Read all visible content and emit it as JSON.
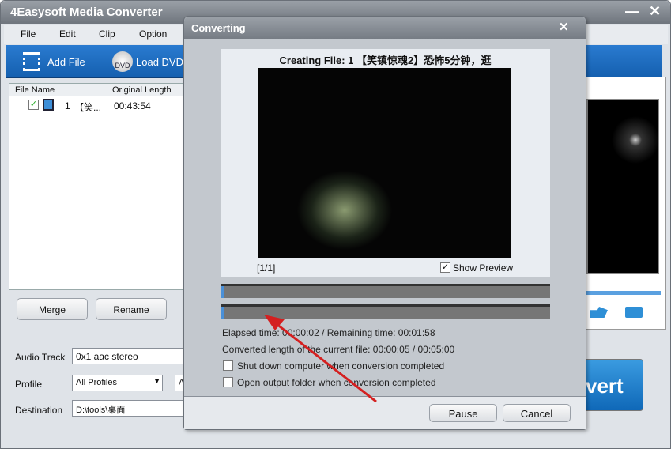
{
  "main": {
    "title": "4Easysoft Media Converter",
    "menu": [
      "File",
      "Edit",
      "Clip",
      "Option"
    ],
    "toolbar": {
      "add_file": "Add File",
      "load_dvd": "Load DVD",
      "dvd_badge": "DVD"
    },
    "filelist": {
      "headers": [
        "File Name",
        "Original Length"
      ],
      "rows": [
        {
          "index": "1",
          "name": "【笑...",
          "length": "00:43:54",
          "checked": true
        }
      ]
    },
    "buttons": {
      "merge": "Merge",
      "rename": "Rename"
    },
    "audio_track": {
      "label": "Audio Track",
      "value": "0x1 aac stereo"
    },
    "profile": {
      "label": "Profile",
      "value": "All Profiles",
      "value2": "A"
    },
    "destination": {
      "label": "Destination",
      "value": "D:\\tools\\桌面"
    },
    "convert_label": "vert"
  },
  "dialog": {
    "title": "Converting",
    "creating_file": "Creating File: 1 【笑镇惊魂2】恐怖5分钟，逛",
    "page": "[1/1]",
    "show_preview": "Show Preview",
    "show_preview_checked": true,
    "progress_total": 0.01,
    "progress_current": 0.01,
    "elapsed": "Elapsed time:  00:00:02 / Remaining time:  00:01:58",
    "converted": "Converted length of the current file:  00:00:05 / 00:05:00",
    "shutdown": "Shut down computer when conversion completed",
    "open_folder": "Open output folder when conversion completed",
    "pause": "Pause",
    "cancel": "Cancel"
  },
  "colors": {
    "toolbar": "#1f6fc0",
    "annotation_arrow": "#d42020"
  }
}
